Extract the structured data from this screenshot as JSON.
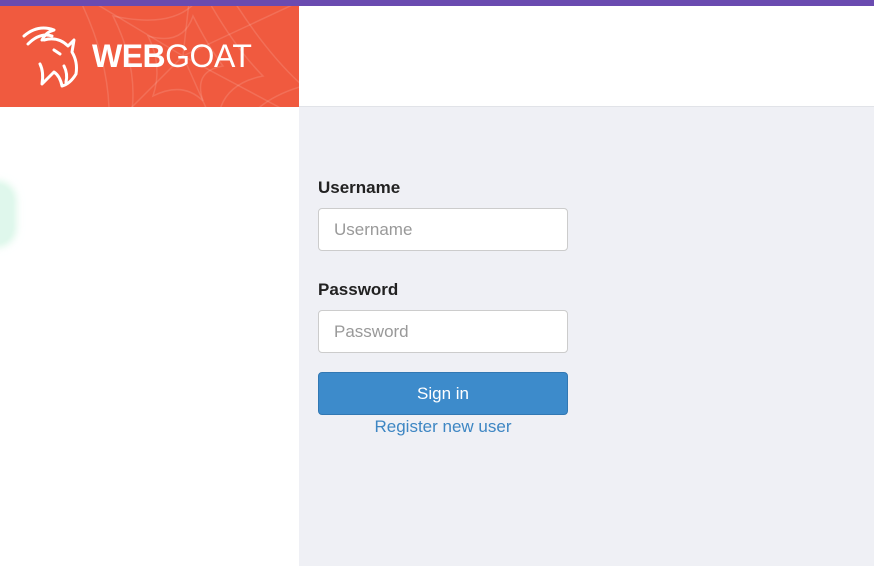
{
  "header": {
    "brand_bold": "WEB",
    "brand_light": "GOAT",
    "logo_icon": "goat-head-icon",
    "colors": {
      "top_bar": "#6a4bb0",
      "brand_bg": "#f05a3f",
      "main_bg": "#eff0f5",
      "button": "#3d8bcb",
      "link": "#3d86c3"
    }
  },
  "login": {
    "username_label": "Username",
    "username_placeholder": "Username",
    "username_value": "",
    "password_label": "Password",
    "password_placeholder": "Password",
    "password_value": "",
    "signin_label": "Sign in",
    "register_label": "Register new user"
  }
}
